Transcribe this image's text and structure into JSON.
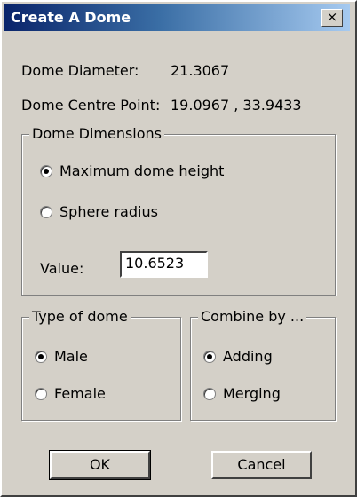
{
  "window": {
    "title": "Create A Dome",
    "close_label": "×"
  },
  "info": {
    "diameter_label": "Dome Diameter:",
    "diameter_value": "21.3067",
    "centre_label": "Dome Centre Point:",
    "centre_value": "19.0967 , 33.9433"
  },
  "dimensions": {
    "legend": "Dome Dimensions",
    "options": [
      {
        "label": "Maximum dome height",
        "checked": true
      },
      {
        "label": "Sphere radius",
        "checked": false
      }
    ],
    "value_label": "Value:",
    "value": "10.6523"
  },
  "type_of_dome": {
    "legend": "Type of dome",
    "options": [
      {
        "label": "Male",
        "checked": true
      },
      {
        "label": "Female",
        "checked": false
      }
    ]
  },
  "combine_by": {
    "legend": "Combine by ...",
    "options": [
      {
        "label": "Adding",
        "checked": true
      },
      {
        "label": "Merging",
        "checked": false
      }
    ]
  },
  "buttons": {
    "ok": "OK",
    "cancel": "Cancel"
  }
}
